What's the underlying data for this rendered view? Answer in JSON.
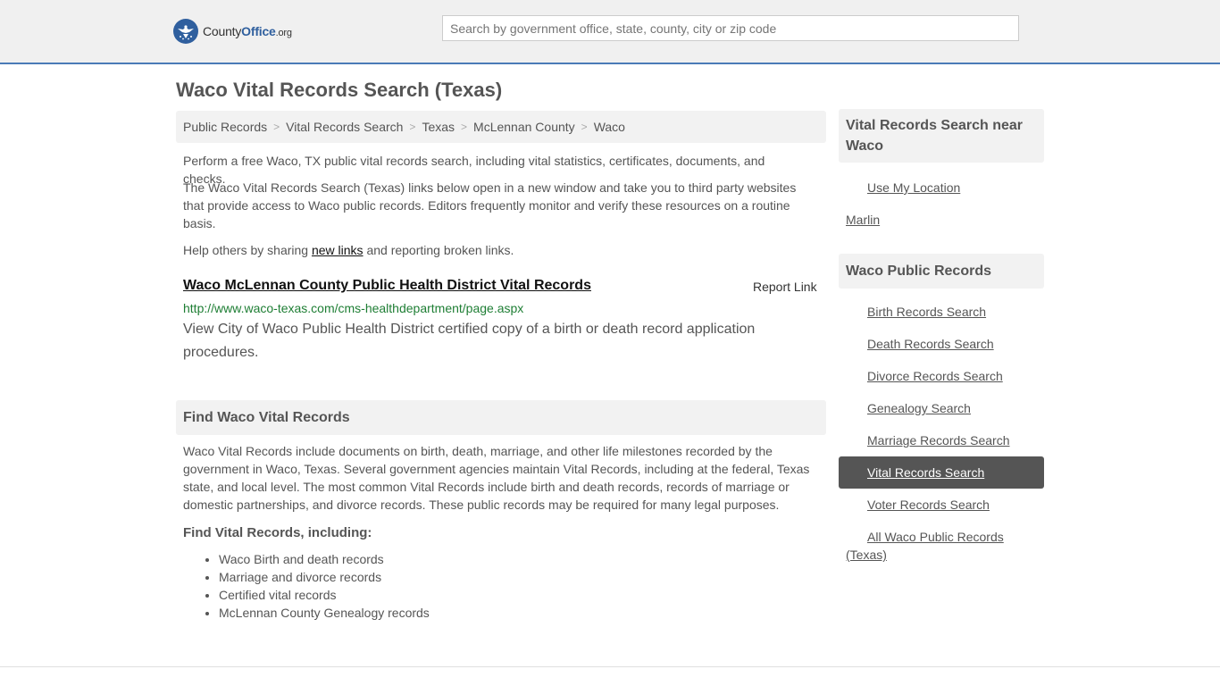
{
  "header": {
    "logo_text_1": "County",
    "logo_text_2": "Office",
    "logo_text_3": ".org",
    "search_placeholder": "Search by government office, state, county, city or zip code"
  },
  "page": {
    "title": "Waco Vital Records Search (Texas)"
  },
  "breadcrumb": [
    "Public Records",
    "Vital Records Search",
    "Texas",
    "McLennan County",
    "Waco"
  ],
  "intro": {
    "p1": "Perform a free Waco, TX public vital records search, including vital statistics, certificates, documents, and checks.",
    "p2": "The Waco Vital Records Search (Texas) links below open in a new window and take you to third party websites that provide access to Waco public records. Editors frequently monitor and verify these resources on a routine basis.",
    "p3_before": "Help others by sharing ",
    "p3_link": "new links",
    "p3_after": " and reporting broken links."
  },
  "result": {
    "title": "Waco McLennan County Public Health District Vital Records",
    "report_label": "Report Link",
    "url": "http://www.waco-texas.com/cms-healthdepartment/page.aspx",
    "description": "View City of Waco Public Health District certified copy of a birth or death record application procedures."
  },
  "find": {
    "heading": "Find Waco Vital Records",
    "body": "Waco Vital Records include documents on birth, death, marriage, and other life milestones recorded by the government in Waco, Texas. Several government agencies maintain Vital Records, including at the federal, Texas state, and local level. The most common Vital Records include birth and death records, records of marriage or domestic partnerships, and divorce records. These public records may be required for many legal purposes.",
    "subheading": "Find Vital Records, including:",
    "items": [
      "Waco Birth and death records",
      "Marriage and divorce records",
      "Certified vital records",
      "McLennan County Genealogy records"
    ]
  },
  "sidebar": {
    "near_heading": "Vital Records Search near Waco",
    "use_location": "Use My Location",
    "near_city": "Marlin",
    "public_heading": "Waco Public Records",
    "links": [
      "Birth Records Search",
      "Death Records Search",
      "Divorce Records Search",
      "Genealogy Search",
      "Marriage Records Search",
      "Vital Records Search",
      "Voter Records Search"
    ],
    "all_line1": "All Waco Public Records",
    "all_line2": "(Texas)"
  }
}
